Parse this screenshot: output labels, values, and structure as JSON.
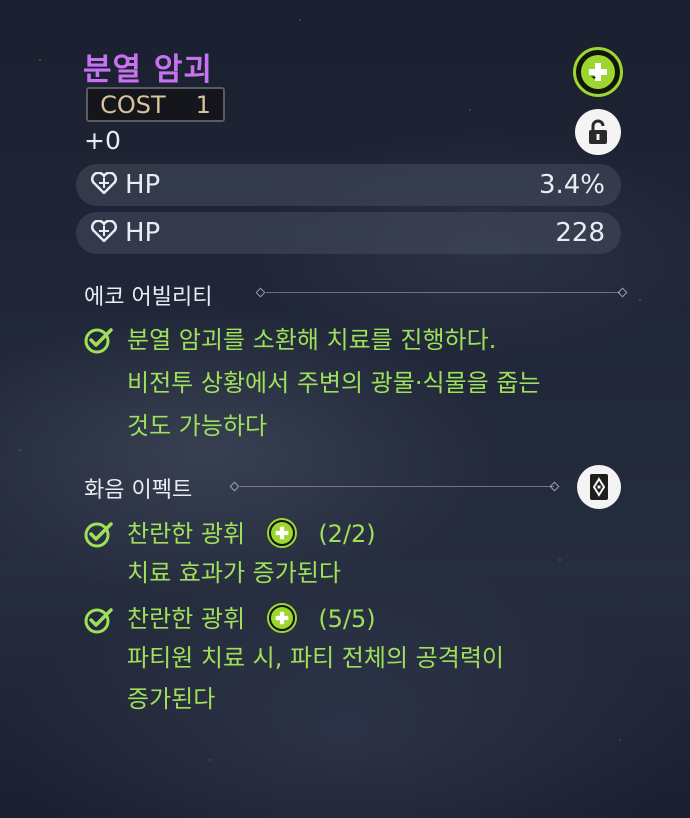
{
  "echo": {
    "name": "분열 암괴",
    "cost_label": "COST",
    "cost_value": "1",
    "level": "+0"
  },
  "stats": [
    {
      "icon": "heart-icon",
      "name": "HP",
      "value": "3.4%"
    },
    {
      "icon": "heart-icon",
      "name": "HP",
      "value": "228"
    }
  ],
  "ability": {
    "title": "에코 어빌리티",
    "lines": [
      "분열 암괴를 소환해 치료를 진행하다.",
      "비전투 상황에서 주변의 광물·식물을 줍는",
      "것도 가능하다"
    ]
  },
  "sonata": {
    "title": "화음 이펙트",
    "effects": [
      {
        "name": "찬란한 광휘",
        "count": "(2/2)",
        "desc": [
          "치료 효과가 증가된다"
        ]
      },
      {
        "name": "찬란한 광휘",
        "count": "(5/5)",
        "desc": [
          "파티원 치료 시, 파티 전체의 공격력이",
          "증가된다"
        ]
      }
    ]
  },
  "colors": {
    "title": "#c772f0",
    "effect_text": "#9ee05a",
    "set_accent": "#9bd631",
    "cost_text": "#d8c49a"
  },
  "icons": [
    "sonata-set-plus-icon",
    "lock-icon",
    "heart-icon",
    "check-circle-icon",
    "book-icon",
    "diamond-icon"
  ]
}
